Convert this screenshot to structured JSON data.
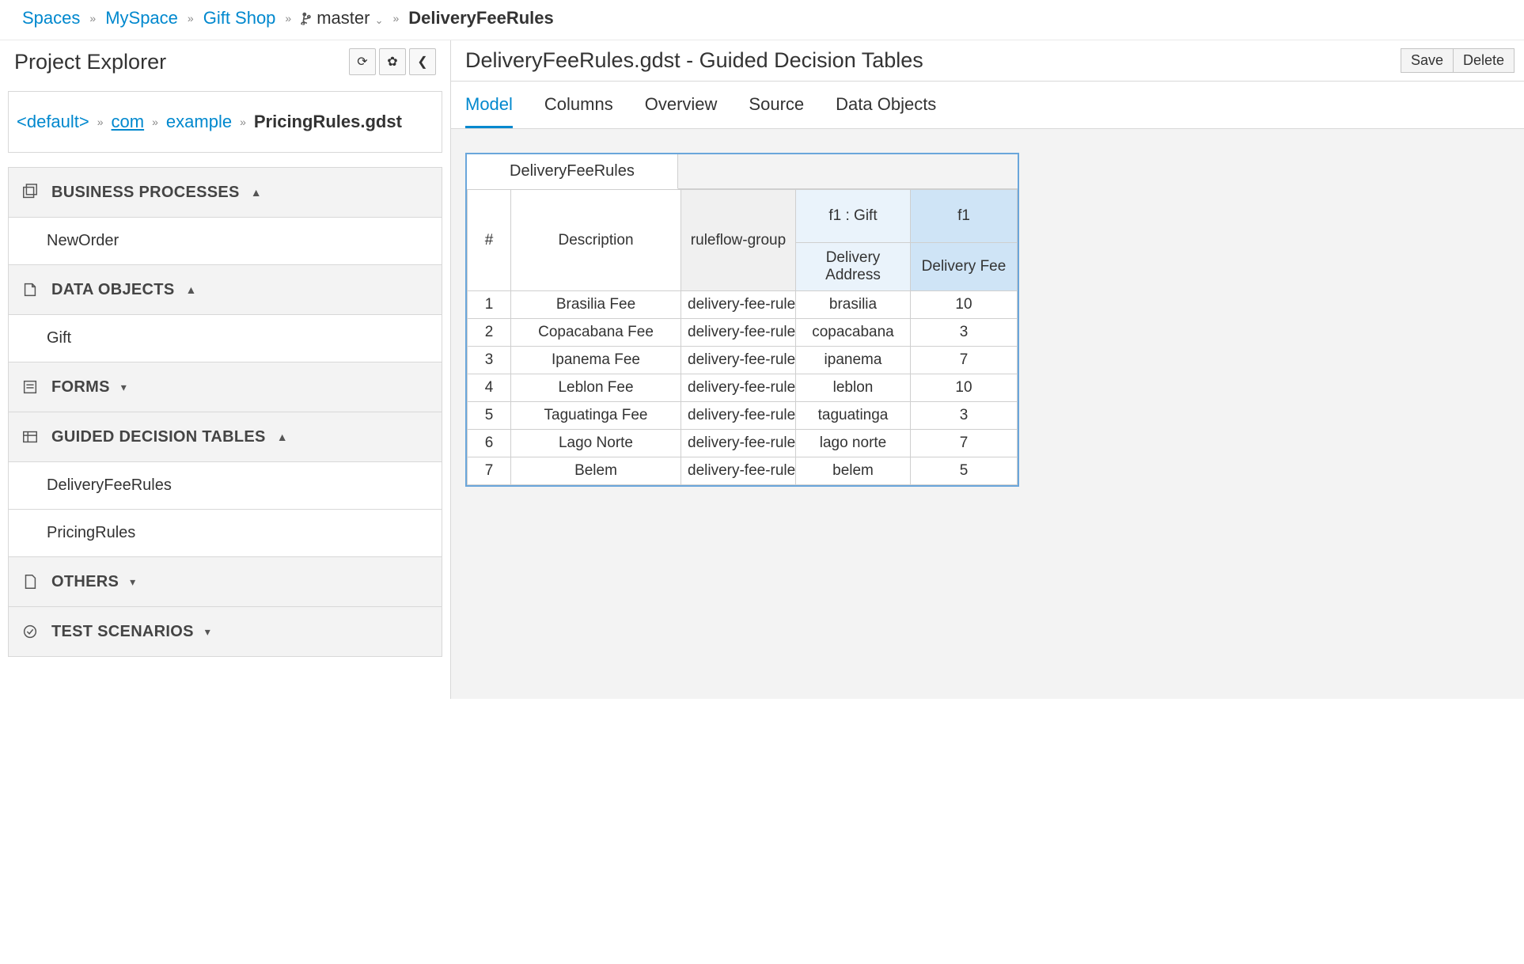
{
  "breadcrumb": {
    "items": [
      "Spaces",
      "MySpace",
      "Gift Shop"
    ],
    "branch": "master",
    "current": "DeliveryFeeRules"
  },
  "sidebar": {
    "title": "Project Explorer",
    "path": {
      "default_label": "<default>",
      "pkg1": "com",
      "pkg2": "example",
      "file": "PricingRules.gdst"
    },
    "sections": [
      {
        "label": "Business Processes",
        "expanded": true,
        "caret": "▲",
        "items": [
          "NewOrder"
        ]
      },
      {
        "label": "Data Objects",
        "expanded": true,
        "caret": "▲",
        "items": [
          "Gift"
        ]
      },
      {
        "label": "Forms",
        "expanded": false,
        "caret": "▾",
        "items": []
      },
      {
        "label": "Guided Decision Tables",
        "expanded": true,
        "caret": "▲",
        "items": [
          "DeliveryFeeRules",
          "PricingRules"
        ]
      },
      {
        "label": "Others",
        "expanded": false,
        "caret": "▾",
        "items": []
      },
      {
        "label": "Test Scenarios",
        "expanded": false,
        "caret": "▾",
        "items": []
      }
    ]
  },
  "editor": {
    "title": "DeliveryFeeRules.gdst - Guided Decision Tables",
    "save_label": "Save",
    "delete_label": "Delete",
    "tabs": [
      "Model",
      "Columns",
      "Overview",
      "Source",
      "Data Objects"
    ],
    "active_tab": 0
  },
  "decision_table": {
    "name": "DeliveryFeeRules",
    "header": {
      "num": "#",
      "desc": "Description",
      "ruleflow": "ruleflow-group",
      "cond_top1": "f1 : Gift",
      "cond_top2": "f1",
      "cond_sub1": "Delivery Address",
      "cond_sub2": "Delivery Fee"
    },
    "rows": [
      {
        "n": "1",
        "desc": "Brasilia Fee",
        "rfg": "delivery-fee-rules",
        "addr": "brasilia",
        "fee": "10"
      },
      {
        "n": "2",
        "desc": "Copacabana Fee",
        "rfg": "delivery-fee-rules",
        "addr": "copacabana",
        "fee": "3"
      },
      {
        "n": "3",
        "desc": "Ipanema Fee",
        "rfg": "delivery-fee-rules",
        "addr": "ipanema",
        "fee": "7"
      },
      {
        "n": "4",
        "desc": "Leblon Fee",
        "rfg": "delivery-fee-rules",
        "addr": "leblon",
        "fee": "10"
      },
      {
        "n": "5",
        "desc": "Taguatinga Fee",
        "rfg": "delivery-fee-rules",
        "addr": "taguatinga",
        "fee": "3"
      },
      {
        "n": "6",
        "desc": "Lago Norte",
        "rfg": "delivery-fee-rules",
        "addr": "lago norte",
        "fee": "7"
      },
      {
        "n": "7",
        "desc": "Belem",
        "rfg": "delivery-fee-rules",
        "addr": "belem",
        "fee": "5"
      }
    ]
  }
}
